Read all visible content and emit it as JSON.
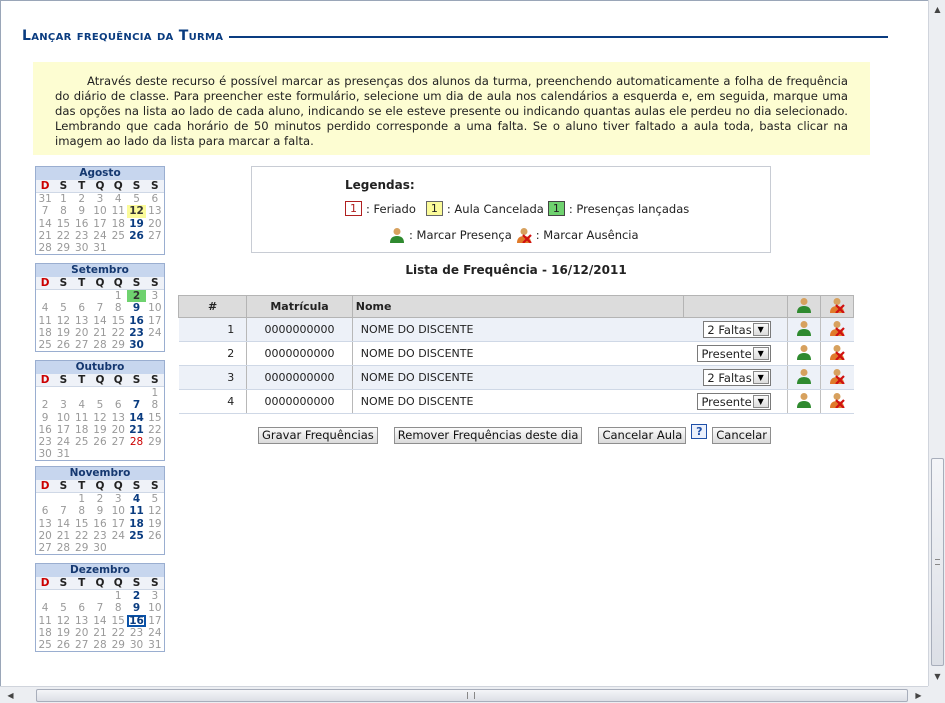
{
  "page": {
    "title": "Lançar frequência da Turma",
    "info": "Através deste recurso é possível marcar as presenças dos alunos da turma, preenchendo automaticamente a folha de frequência do diário de classe. Para preencher este formulário, selecione um dia de aula nos calendários a esquerda e, em seguida, marque uma das opções na lista ao lado de cada aluno, indicando se ele esteve presente ou indicando quantas aulas ele perdeu no dia selecionado. Lembrando que cada horário de 50 minutos perdido corresponde a uma falta. Se o aluno tiver faltado a aula toda, basta clicar na imagem ao lado da lista para marcar a falta."
  },
  "weekdays": [
    "D",
    "S",
    "T",
    "Q",
    "Q",
    "S",
    "S"
  ],
  "calendars": [
    {
      "month": "Agosto",
      "weeks": [
        [
          "31",
          "1",
          "2",
          "3",
          "4",
          "5",
          "6"
        ],
        [
          "7",
          "8",
          "9",
          "10",
          "11",
          "12",
          "13"
        ],
        [
          "14",
          "15",
          "16",
          "17",
          "18",
          "19",
          "20"
        ],
        [
          "21",
          "22",
          "23",
          "24",
          "25",
          "26",
          "27"
        ],
        [
          "28",
          "29",
          "30",
          "31",
          "",
          "",
          ""
        ]
      ]
    },
    {
      "month": "Setembro",
      "weeks": [
        [
          "",
          "",
          "",
          "",
          "1",
          "2",
          "3"
        ],
        [
          "4",
          "5",
          "6",
          "7",
          "8",
          "9",
          "10"
        ],
        [
          "11",
          "12",
          "13",
          "14",
          "15",
          "16",
          "17"
        ],
        [
          "18",
          "19",
          "20",
          "21",
          "22",
          "23",
          "24"
        ],
        [
          "25",
          "26",
          "27",
          "28",
          "29",
          "30",
          ""
        ]
      ]
    },
    {
      "month": "Outubro",
      "weeks": [
        [
          "",
          "",
          "",
          "",
          "",
          "",
          "1"
        ],
        [
          "2",
          "3",
          "4",
          "5",
          "6",
          "7",
          "8"
        ],
        [
          "9",
          "10",
          "11",
          "12",
          "13",
          "14",
          "15"
        ],
        [
          "16",
          "17",
          "18",
          "19",
          "20",
          "21",
          "22"
        ],
        [
          "23",
          "24",
          "25",
          "26",
          "27",
          "28",
          "29"
        ],
        [
          "30",
          "31",
          "",
          "",
          "",
          "",
          ""
        ]
      ]
    },
    {
      "month": "Novembro",
      "weeks": [
        [
          "",
          "",
          "1",
          "2",
          "3",
          "4",
          "5"
        ],
        [
          "6",
          "7",
          "8",
          "9",
          "10",
          "11",
          "12"
        ],
        [
          "13",
          "14",
          "15",
          "16",
          "17",
          "18",
          "19"
        ],
        [
          "20",
          "21",
          "22",
          "23",
          "24",
          "25",
          "26"
        ],
        [
          "27",
          "28",
          "29",
          "30",
          "",
          "",
          ""
        ]
      ]
    },
    {
      "month": "Dezembro",
      "weeks": [
        [
          "",
          "",
          "",
          "",
          "1",
          "2",
          "3"
        ],
        [
          "4",
          "5",
          "6",
          "7",
          "8",
          "9",
          "10"
        ],
        [
          "11",
          "12",
          "13",
          "14",
          "15",
          "16",
          "17"
        ],
        [
          "18",
          "19",
          "20",
          "21",
          "22",
          "23",
          "24"
        ],
        [
          "25",
          "26",
          "27",
          "28",
          "29",
          "30",
          "31"
        ]
      ]
    }
  ],
  "legend": {
    "title": "Legendas:",
    "swatch_number": "1",
    "feriado": ": Feriado",
    "cancelada": ": Aula Cancelada",
    "lancadas": ": Presenças lançadas",
    "marcar_presenca": ": Marcar Presença",
    "marcar_ausencia": ": Marcar Ausência"
  },
  "list_title": "Lista de Frequência - 16/12/2011",
  "table": {
    "headers": [
      "#",
      "Matrícula",
      "Nome",
      ""
    ],
    "rows": [
      {
        "num": "1",
        "matricula": "0000000000",
        "nome": "NOME DO DISCENTE",
        "status": "2 Faltas"
      },
      {
        "num": "2",
        "matricula": "0000000000",
        "nome": "NOME DO DISCENTE",
        "status": "Presente"
      },
      {
        "num": "3",
        "matricula": "0000000000",
        "nome": "NOME DO DISCENTE",
        "status": "2 Faltas"
      },
      {
        "num": "4",
        "matricula": "0000000000",
        "nome": "NOME DO DISCENTE",
        "status": "Presente"
      }
    ]
  },
  "buttons": {
    "gravar": "Gravar Frequências",
    "remover": "Remover Frequências deste dia",
    "cancelar_aula": "Cancelar Aula",
    "help": "?",
    "cancelar": "Cancelar"
  },
  "colors": {
    "title": "#0a3c80",
    "info_bg": "#fdfdd2",
    "holiday": "#cc0000",
    "canceled": "#fbfb9a",
    "launched": "#6fd26f"
  }
}
